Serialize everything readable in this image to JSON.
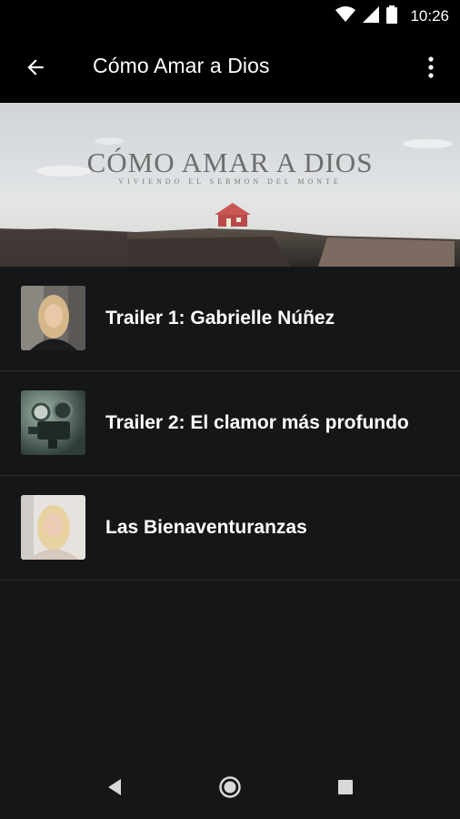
{
  "status_bar": {
    "time": "10:26",
    "icons": [
      "wifi-icon",
      "signal-icon",
      "battery-icon"
    ]
  },
  "app_bar": {
    "title": "Cómo Amar a Dios",
    "back_icon": "arrow-back-icon",
    "menu_icon": "more-vert-icon"
  },
  "banner": {
    "title": "CÓMO AMAR A DIOS",
    "subtitle": "VIVIENDO EL SERMON DEL MONTE"
  },
  "videos": [
    {
      "title": "Trailer 1: Gabrielle Núñez",
      "thumb": "woman-portrait"
    },
    {
      "title": "Trailer 2: El clamor más profundo",
      "thumb": "film-projector"
    },
    {
      "title": "Las Bienaventuranzas",
      "thumb": "woman-portrait-light"
    }
  ],
  "nav_bar": {
    "icons": [
      "nav-back-icon",
      "nav-home-icon",
      "nav-recents-icon"
    ]
  },
  "colors": {
    "background": "#151618",
    "bar": "#000000",
    "divider": "#2a2b2d",
    "text": "#ffffff"
  }
}
